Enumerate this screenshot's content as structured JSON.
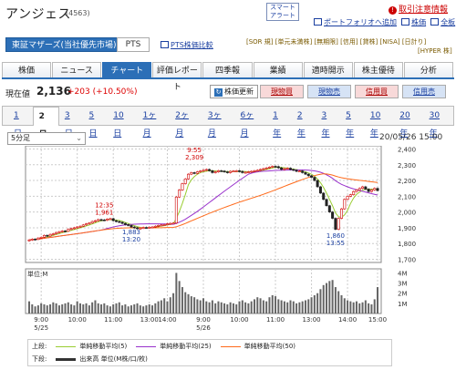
{
  "header": {
    "company": "アンジェス",
    "code": "(4563)",
    "smart_alert": "スマート\nアラート",
    "order_link": "取引注意情報",
    "portfolio_link": "ポートフォリオへ追加",
    "stock_report_link": "株価",
    "full_report_link": "全板"
  },
  "market": {
    "selected": "東証マザーズ(当社優先市場)",
    "pts": "PTS",
    "pts_compare": "PTS株価比較",
    "tags": "[SOR 規] [単元未満株] [無期限] [信用] [貸株] [NISA] [日計り]",
    "tags2": "[HYPER 株]"
  },
  "tabs": [
    "株価",
    "ニュース",
    "チャート",
    "評価レポート",
    "四季報",
    "業績",
    "適時開示",
    "株主優待",
    "分析"
  ],
  "active_tab": "チャート",
  "quote": {
    "label": "現在値",
    "price": "2,136",
    "change": "+203 (+10.50%)",
    "update": "株価更新",
    "buy_spot": "現物買",
    "sell_spot": "現物売",
    "buy_margin": "信用買",
    "sell_margin": "信用売"
  },
  "ranges": [
    "1日",
    "2日",
    "3日",
    "5日",
    "10日",
    "1ヶ月",
    "2ヶ月",
    "3ヶ月",
    "6ヶ月",
    "1年",
    "2年",
    "3年",
    "5年",
    "10年",
    "20年",
    "30年"
  ],
  "active_range": "2日",
  "interval": "5分足",
  "datetime": "20/05/26 15:00",
  "colors": {
    "accent": "#2c6fb7",
    "up": "#d00000",
    "down": "#1a3fa0",
    "ma5": "#9acd32",
    "ma25": "#9932cc",
    "ma50": "#ff6a1a"
  },
  "chart_data": {
    "type": "candlestick",
    "interval": "5分足",
    "x_ticks": [
      "9:00",
      "10:00",
      "11:00",
      "13:00",
      "14:00",
      "9:00",
      "10:00",
      "11:00",
      "13:00",
      "14:00",
      "15:00"
    ],
    "dates": [
      "5/25",
      "5/26"
    ],
    "y_ticks": [
      1700,
      1800,
      1900,
      2000,
      2100,
      2200,
      2300,
      2400
    ],
    "ylim": [
      1680,
      2420
    ],
    "annotations": [
      {
        "time": "12:35",
        "value": "1,961"
      },
      {
        "time": "13:20",
        "value": "1,883"
      },
      {
        "time": "9:55",
        "value": "2,309"
      },
      {
        "time": "13:55",
        "value": "1,860"
      }
    ],
    "close": [
      1823,
      1828,
      1826,
      1835,
      1840,
      1852,
      1848,
      1858,
      1862,
      1870,
      1875,
      1880,
      1878,
      1890,
      1895,
      1900,
      1905,
      1910,
      1918,
      1925,
      1930,
      1940,
      1945,
      1952,
      1950,
      1948,
      1955,
      1958,
      1945,
      1940,
      1935,
      1928,
      1920,
      1915,
      1905,
      1900,
      1895,
      1898,
      1902,
      1900,
      1903,
      1905,
      1910,
      1915,
      1918,
      1920,
      1925,
      1928,
      1930,
      2095,
      2140,
      2180,
      2210,
      2240,
      2250,
      2245,
      2255,
      2260,
      2265,
      2270,
      2262,
      2250,
      2255,
      2262,
      2260,
      2255,
      2250,
      2258,
      2260,
      2262,
      2258,
      2250,
      2252,
      2255,
      2258,
      2262,
      2265,
      2270,
      2275,
      2280,
      2285,
      2290,
      2288,
      2280,
      2270,
      2275,
      2278,
      2270,
      2265,
      2258,
      2260,
      2250,
      2240,
      2230,
      2220,
      2200,
      2160,
      2120,
      2080,
      2040,
      2000,
      1960,
      1890,
      1960,
      2020,
      2080,
      2100,
      2110,
      2130,
      2140,
      2150,
      2160,
      2145,
      2130,
      2140,
      2150,
      2136
    ],
    "volume_ticks": [
      "4M",
      "3M",
      "2M",
      "1M"
    ],
    "volume_label": "単位:M",
    "volume": [
      1.2,
      0.9,
      0.7,
      0.8,
      1.0,
      0.9,
      0.8,
      0.9,
      1.1,
      1.0,
      0.8,
      0.9,
      1.0,
      1.1,
      0.9,
      0.8,
      1.2,
      1.0,
      0.9,
      1.0,
      0.8,
      1.1,
      1.3,
      1.0,
      0.9,
      1.0,
      0.8,
      0.7,
      0.9,
      1.0,
      1.1,
      0.8,
      0.9,
      0.7,
      0.8,
      0.9,
      1.0,
      0.8,
      0.7,
      0.8,
      0.9,
      0.8,
      1.0,
      1.2,
      1.3,
      1.5,
      1.2,
      1.6,
      2.0,
      4.0,
      3.2,
      2.6,
      2.1,
      1.9,
      1.7,
      1.6,
      1.4,
      1.3,
      1.5,
      1.2,
      1.1,
      1.3,
      1.0,
      1.2,
      1.1,
      1.0,
      0.9,
      1.1,
      1.0,
      0.9,
      1.2,
      1.3,
      1.1,
      1.0,
      1.2,
      1.4,
      1.6,
      1.5,
      1.3,
      1.2,
      1.6,
      1.8,
      1.7,
      1.4,
      1.3,
      1.2,
      1.1,
      1.3,
      1.2,
      1.0,
      1.1,
      1.2,
      1.3,
      1.4,
      1.6,
      1.8,
      2.0,
      2.4,
      2.8,
      3.0,
      3.2,
      3.3,
      2.6,
      2.2,
      1.8,
      1.5,
      1.3,
      1.2,
      1.1,
      1.2,
      1.0,
      1.1,
      1.3,
      1.0,
      0.9,
      1.4,
      2.6
    ]
  },
  "legend": {
    "upper": "上段:",
    "ma5": "単純移動平均(5)",
    "ma25": "単純移動平均(25)",
    "ma50": "単純移動平均(50)",
    "lower": "下段:",
    "volume": "出来高 単位(M株/口/枚)"
  }
}
